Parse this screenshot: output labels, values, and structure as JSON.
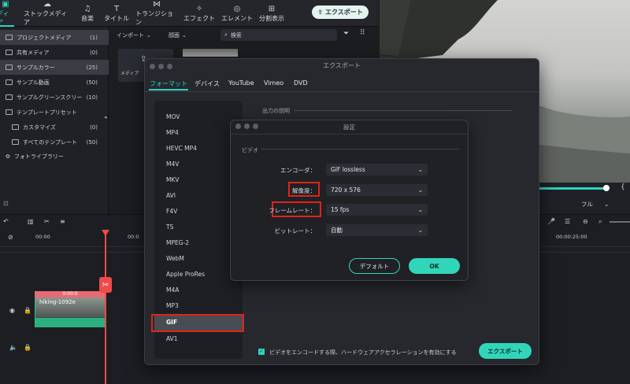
{
  "topbar": {
    "tabs": [
      {
        "label": "ディア",
        "icon": "media-icon"
      },
      {
        "label": "ストックメディア",
        "icon": "stock-media-icon"
      },
      {
        "label": "音楽",
        "icon": "music-icon"
      },
      {
        "label": "タイトル",
        "icon": "title-icon"
      },
      {
        "label": "トランジション",
        "icon": "transition-icon"
      },
      {
        "label": "エフェクト",
        "icon": "effect-icon"
      },
      {
        "label": "エレメント",
        "icon": "element-icon"
      },
      {
        "label": "分割表示",
        "icon": "split-screen-icon"
      }
    ],
    "export_label": "エクスポート"
  },
  "sidebar": {
    "items": [
      {
        "label": "プロジェクトメディア",
        "count": "(1)"
      },
      {
        "label": "共有メディア",
        "count": "(0)"
      },
      {
        "label": "サンプルカラー",
        "count": "(25)"
      },
      {
        "label": "サンプル動画",
        "count": "(50)"
      },
      {
        "label": "サンプルグリーンスクリー",
        "count": "(10)"
      },
      {
        "label": "テンプレートプリセット",
        "count": ""
      },
      {
        "label": "カスタマイズ",
        "count": "(0)"
      },
      {
        "label": "すべてのテンプレート",
        "count": "(50)"
      },
      {
        "label": "フォトライブラリー",
        "count": ""
      }
    ]
  },
  "media": {
    "import_label": "インポート",
    "sort_label": "顔面",
    "search_placeholder": "検索",
    "card_label": "メディア"
  },
  "preview": {
    "quality_label": "フル"
  },
  "timeline": {
    "ruler": [
      "00:00",
      "00:0",
      "00:00:25:00"
    ],
    "clip_duration": "0:00:0",
    "clip_name": "hiking-1092e"
  },
  "export_dialog": {
    "title": "エクスポート",
    "tabs": [
      "フォーマット",
      "デバイス",
      "YouTube",
      "Vimeo",
      "DVD"
    ],
    "formats": [
      "MOV",
      "MP4",
      "HEVC MP4",
      "M4V",
      "MKV",
      "AVI",
      "F4V",
      "TS",
      "MPEG-2",
      "WebM",
      "Apple ProRes",
      "M4A",
      "MP3",
      "GIF",
      "AV1"
    ],
    "selected_format": "GIF",
    "output_desc_label": "出力の説明",
    "hwaccel_label": "ビデオをエンコードする際、ハードウェアアクセラレーションを有効にする",
    "hwaccel_checked": true,
    "export_button": "エクスポート"
  },
  "settings_dialog": {
    "title": "設定",
    "section_label": "ビデオ",
    "rows": [
      {
        "label": "エンコーダ：",
        "value": "GIF lossless"
      },
      {
        "label": "解像度：",
        "value": "720 x 576"
      },
      {
        "label": "フレームレート：",
        "value": "15 fps"
      },
      {
        "label": "ビットレート：",
        "value": "自動"
      }
    ],
    "default_button": "デフォルト",
    "ok_button": "OK"
  },
  "colors": {
    "accent": "#2fd3c0",
    "highlight_box": "#e0241b",
    "playhead": "#f04a4a"
  }
}
